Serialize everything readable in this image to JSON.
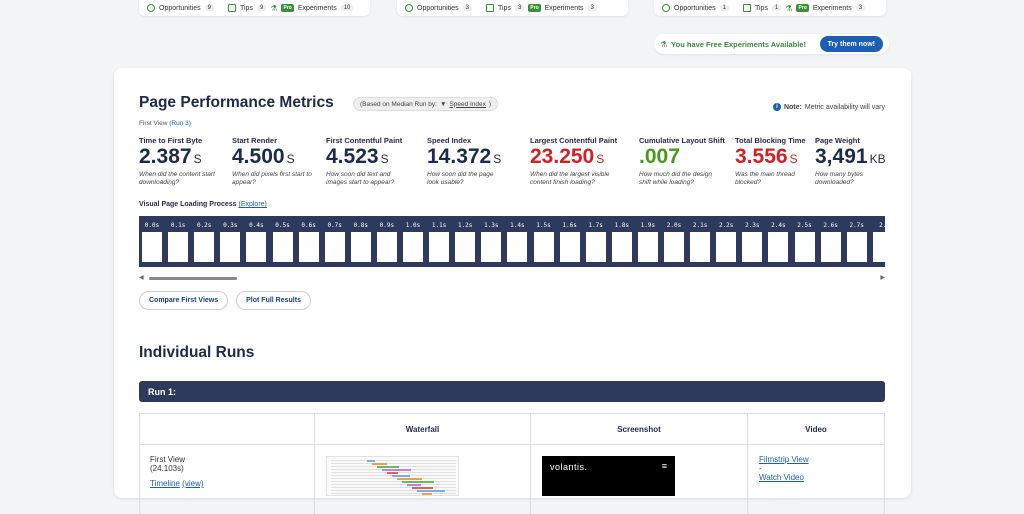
{
  "top_cards": [
    {
      "opportunities_label": "Opportunities",
      "opportunities_count": "9",
      "tips_label": "Tips",
      "tips_count": "9",
      "pro_badge": "Pro",
      "experiments_label": "Experiments",
      "experiments_count": "10"
    },
    {
      "opportunities_label": "Opportunities",
      "opportunities_count": "3",
      "tips_label": "Tips",
      "tips_count": "3",
      "pro_badge": "Pro",
      "experiments_label": "Experiments",
      "experiments_count": "3"
    },
    {
      "opportunities_label": "Opportunities",
      "opportunities_count": "1",
      "tips_label": "Tips",
      "tips_count": "1",
      "pro_badge": "Pro",
      "experiments_label": "Experiments",
      "experiments_count": "3"
    }
  ],
  "free_experiments": {
    "text": "You have Free Experiments Available!",
    "button": "Try them now!"
  },
  "performance": {
    "title": "Page Performance Metrics",
    "median_prefix": "(Based on Median Run by:",
    "median_arrow": "▼",
    "median_metric": "Speed Index",
    "median_suffix": ")",
    "note_label": "Note:",
    "note_text": "Metric availability will vary",
    "view_label": "First View",
    "run_link": "(Run 3)",
    "metrics": [
      {
        "label": "Time to First Byte",
        "value": "2.387",
        "unit": "S",
        "desc": "When did the content start downloading?",
        "color": "default"
      },
      {
        "label": "Start Render",
        "value": "4.500",
        "unit": "S",
        "desc": "When did pixels first start to appear?",
        "color": "default"
      },
      {
        "label": "First Contentful Paint",
        "value": "4.523",
        "unit": "S",
        "desc": "How soon did text and images start to appear?",
        "color": "default"
      },
      {
        "label": "Speed Index",
        "value": "14.372",
        "unit": "S",
        "desc": "How soon did the page look usable?",
        "color": "default"
      },
      {
        "label": "Largest Contentful Paint",
        "value": "23.250",
        "unit": "S",
        "desc": "When did the largest visible content finish loading?",
        "color": "red"
      },
      {
        "label": "Cumulative Layout Shift",
        "value": ".007",
        "unit": "",
        "desc": "How much did the design shift while loading?",
        "color": "green"
      },
      {
        "label": "Total Blocking Time",
        "value": "3.556",
        "unit": "S",
        "desc": "Was the main thread blocked?",
        "color": "red"
      },
      {
        "label": "Page Weight",
        "value": "3,491",
        "unit": "KB",
        "desc": "How many bytes downloaded?",
        "color": "default"
      }
    ],
    "visual_loading_label": "Visual Page Loading Process",
    "explore_link": "(Explore)",
    "frames": [
      "0.0s",
      "0.1s",
      "0.2s",
      "0.3s",
      "0.4s",
      "0.5s",
      "0.6s",
      "0.7s",
      "0.8s",
      "0.9s",
      "1.0s",
      "1.1s",
      "1.2s",
      "1.3s",
      "1.4s",
      "1.5s",
      "1.6s",
      "1.7s",
      "1.8s",
      "1.9s",
      "2.0s",
      "2.1s",
      "2.2s",
      "2.3s",
      "2.4s",
      "2.5s",
      "2.6s",
      "2.7s",
      "2."
    ],
    "compare_button": "Compare First Views",
    "plot_button": "Plot Full Results"
  },
  "individual_runs": {
    "title": "Individual Runs",
    "run_label": "Run 1:",
    "columns": [
      "",
      "Waterfall",
      "Screenshot",
      "Video"
    ],
    "first_view_label": "First View",
    "first_view_time": "(24.103s)",
    "timeline_label": "Timeline",
    "timeline_link": "(view)",
    "screenshot_logo": "volantis.",
    "filmstrip_link": "Filmstrip View",
    "dash": "-",
    "watch_link": "Watch Video"
  },
  "colors": {
    "navy": "#2d3a5e",
    "accent": "#1a5fb4",
    "red": "#d32020",
    "green": "#4a9a1a"
  }
}
